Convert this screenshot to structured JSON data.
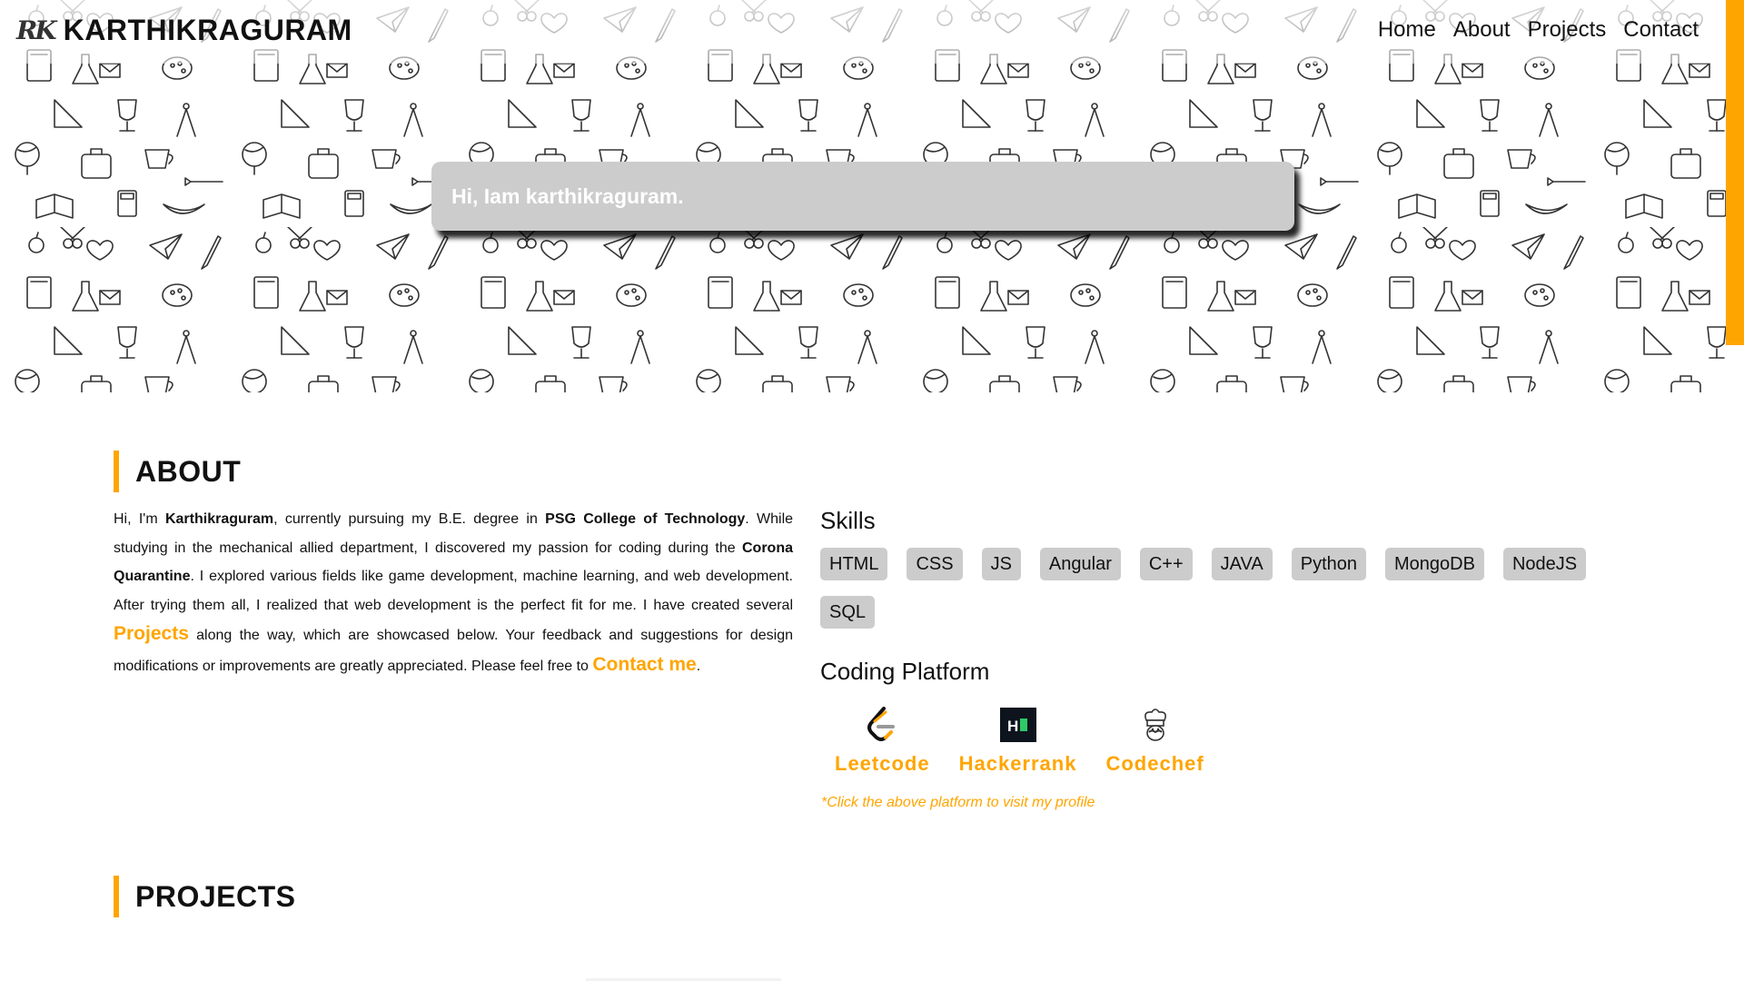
{
  "nav": {
    "logo": "RK",
    "brand": "KARTHIKRAGURAM",
    "links": [
      "Home",
      "About",
      "Projects",
      "Contact"
    ]
  },
  "hero": {
    "greeting": "Hi, Iam karthikraguram."
  },
  "about": {
    "title": "ABOUT",
    "p1": "Hi, I'm ",
    "name": "Karthikraguram",
    "p2": ", currently pursuing my B.E. degree in ",
    "college": "PSG College of Technology",
    "p3": ". While studying in the mechanical allied department, I discovered my passion for coding during the ",
    "quarantine": "Corona Quarantine",
    "p4": ". I explored various fields like game development, machine learning, and web development. After trying them all, I realized that web development is the perfect fit for me. I have created several ",
    "projects_link": "Projects",
    "p5": " along the way, which are showcased below. Your feedback and suggestions for design modifications or improvements are greatly appreciated. Please feel free to ",
    "contact_link": "Contact me",
    "p6": "."
  },
  "skills": {
    "title": "Skills",
    "items": [
      "HTML",
      "CSS",
      "JS",
      "Angular",
      "C++",
      "JAVA",
      "Python",
      "MongoDB",
      "NodeJS",
      "SQL"
    ]
  },
  "coding": {
    "title": "Coding Platform",
    "platforms": [
      {
        "label": "Leetcode",
        "icon": "leetcode-icon"
      },
      {
        "label": "Hackerrank",
        "icon": "hackerrank-icon"
      },
      {
        "label": "Codechef",
        "icon": "codechef-icon"
      }
    ],
    "note": "*Click the above platform to visit my profile"
  },
  "projects": {
    "title": "PROJECTS"
  },
  "colors": {
    "accent": "#ffa500",
    "chip": "#cccccc",
    "text": "#111111"
  }
}
